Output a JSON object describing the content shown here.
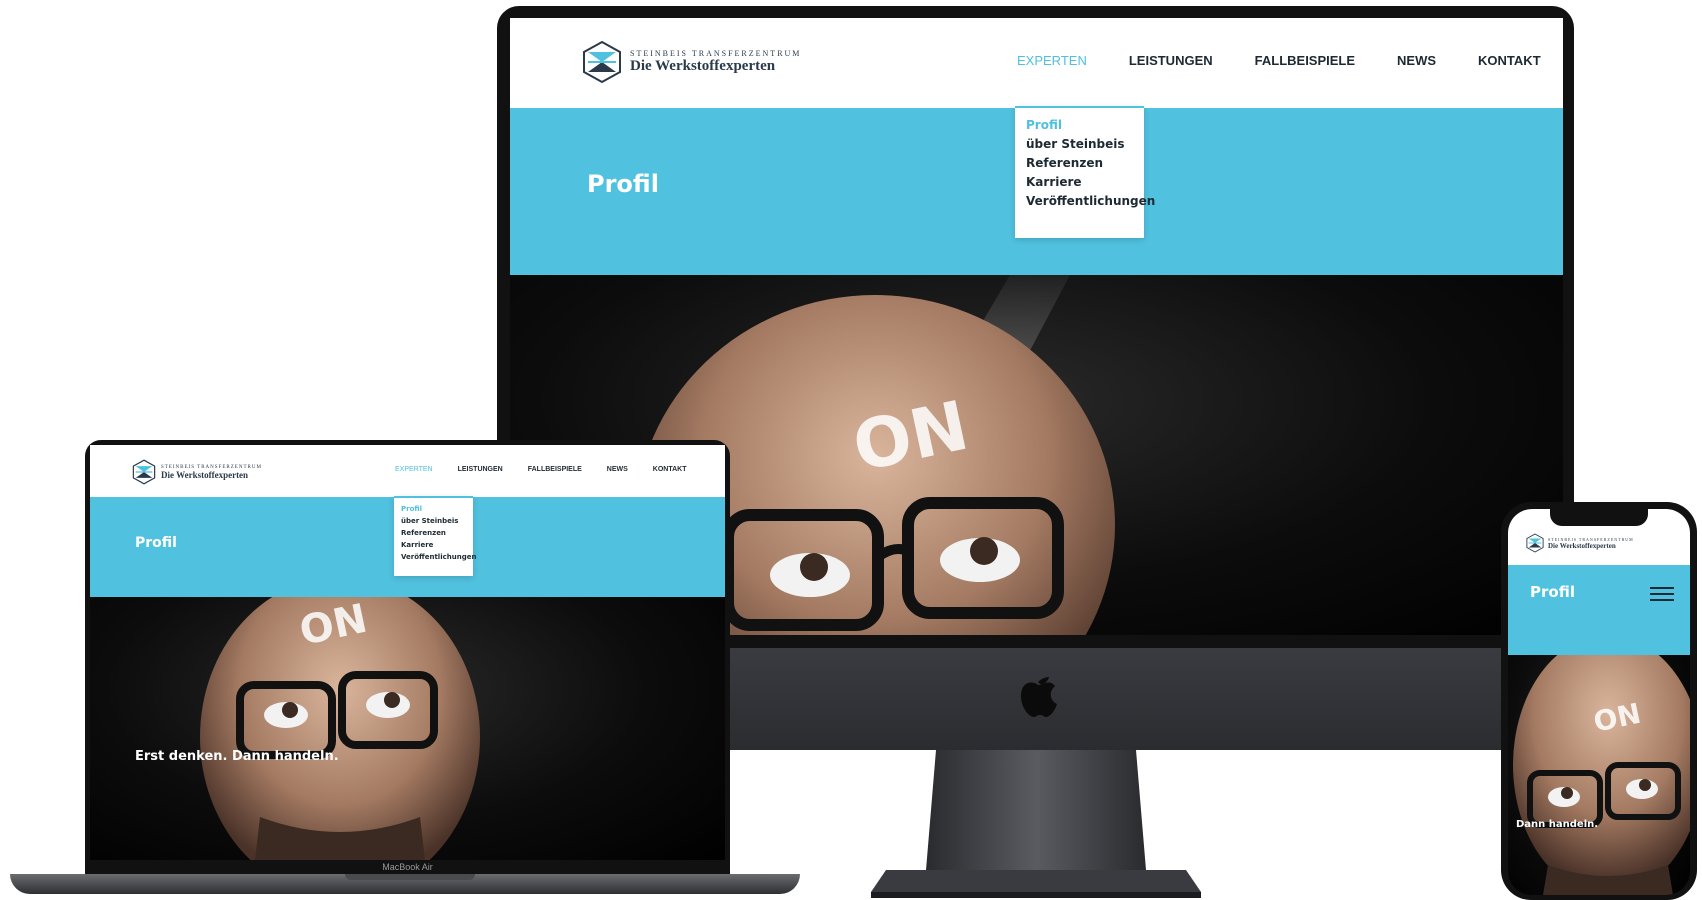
{
  "site": {
    "logo_top": "Steinbeis Transferzentrum",
    "logo_bottom": "Die Werkstoffexperten",
    "nav": [
      {
        "label": "Experten",
        "active": true
      },
      {
        "label": "Leistungen",
        "active": false
      },
      {
        "label": "Fallbeispiele",
        "active": false
      },
      {
        "label": "News",
        "active": false
      },
      {
        "label": "Kontakt",
        "active": false
      }
    ],
    "dropdown": [
      "Profil",
      "über Steinbeis",
      "Referenzen",
      "Karriere",
      "Veröffentlichungen"
    ],
    "page_title": "Profil",
    "tagline": "Erst denken. Dann handeln.",
    "phone_tagline": "Dann handeln.",
    "photo_glow_text": "ON"
  },
  "devices": {
    "laptop_label": "MacBook Air"
  },
  "colors": {
    "accent": "#50c1df",
    "nav_text": "#1e2a33",
    "logo_text": "#2a3a4a"
  },
  "icons": [
    "steinbeis-logo-icon",
    "apple-logo-icon",
    "hamburger-menu-icon"
  ]
}
